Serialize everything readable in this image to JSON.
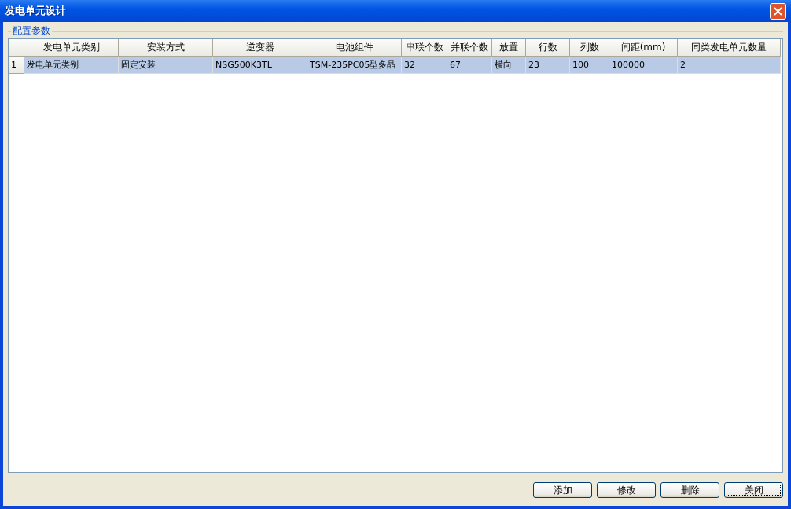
{
  "window": {
    "title": "发电单元设计"
  },
  "group": {
    "title": "配置参数"
  },
  "table": {
    "columns": [
      "发电单元类别",
      "安装方式",
      "逆变器",
      "电池组件",
      "串联个数",
      "并联个数",
      "放置",
      "行数",
      "列数",
      "间距(mm)",
      "同类发电单元数量"
    ],
    "rows": [
      {
        "number": "1",
        "selected": true,
        "cells": [
          "发电单元类别",
          "固定安装",
          "NSG500K3TL",
          "TSM-235PC05型多晶",
          "32",
          "67",
          "横向",
          "23",
          "100",
          "100000",
          "2"
        ]
      }
    ]
  },
  "buttons": [
    {
      "label": "添加",
      "focused": false
    },
    {
      "label": "修改",
      "focused": false
    },
    {
      "label": "删除",
      "focused": false
    },
    {
      "label": "关闭",
      "focused": true
    }
  ]
}
